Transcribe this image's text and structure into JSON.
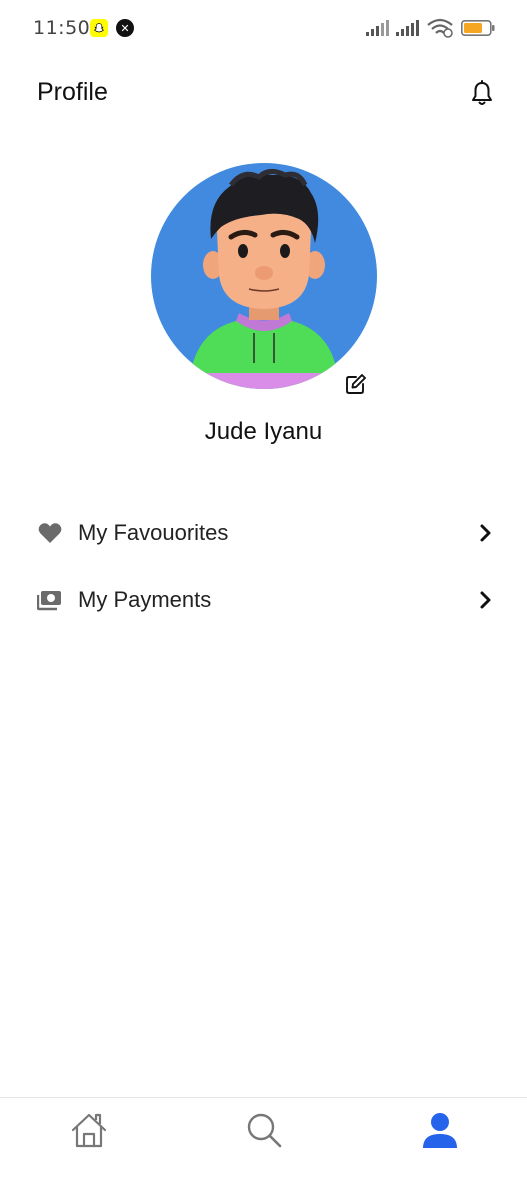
{
  "status_bar": {
    "time": "11:50",
    "notification_icons": [
      "snapchat-icon",
      "x-icon"
    ],
    "battery_color": "#f5a623"
  },
  "header": {
    "title": "Profile",
    "notification_icon": "bell-icon"
  },
  "profile": {
    "name": "Jude Iyanu",
    "avatar_bg": "#418ae0",
    "edit_icon": "edit-icon"
  },
  "menu": {
    "items": [
      {
        "label": "My Favouorites",
        "icon": "heart-icon"
      },
      {
        "label": "My Payments",
        "icon": "payments-icon"
      }
    ]
  },
  "bottom_nav": {
    "items": [
      {
        "icon": "home-icon",
        "active": false
      },
      {
        "icon": "search-icon",
        "active": false
      },
      {
        "icon": "person-icon",
        "active": true
      }
    ],
    "active_color": "#2563eb",
    "inactive_color": "#777777"
  }
}
